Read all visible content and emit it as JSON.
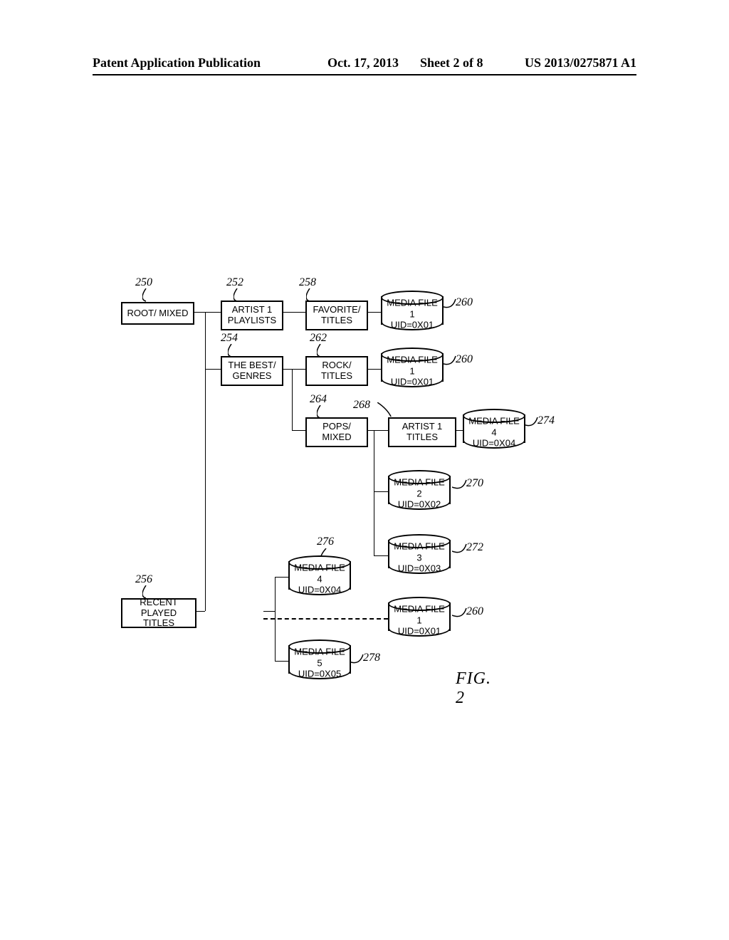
{
  "header": {
    "pubtype": "Patent Application Publication",
    "date": "Oct. 17, 2013",
    "sheet": "Sheet 2 of 8",
    "pubno": "US 2013/0275871 A1"
  },
  "refs": {
    "r250": "250",
    "r252": "252",
    "r254": "254",
    "r256": "256",
    "r258": "258",
    "r260": "260",
    "r262": "262",
    "r264": "264",
    "r268": "268",
    "r270": "270",
    "r272": "272",
    "r274": "274",
    "r276": "276",
    "r278": "278"
  },
  "nodes": {
    "root": {
      "l1": "ROOT/ MIXED"
    },
    "artist1_playlists": {
      "l1": "ARTIST 1",
      "l2": "PLAYLISTS"
    },
    "the_best_genres": {
      "l1": "THE BEST/",
      "l2": "GENRES"
    },
    "favorite_titles": {
      "l1": "FAVORITE/",
      "l2": "TITLES"
    },
    "rock_titles": {
      "l1": "ROCK/",
      "l2": "TITLES"
    },
    "pops_mixed": {
      "l1": "POPS/",
      "l2": "MIXED"
    },
    "artist1_titles": {
      "l1": "ARTIST 1",
      "l2": "TITLES"
    },
    "recent_played_titles": {
      "l1": "RECENT PLAYED",
      "l2": "TITLES"
    }
  },
  "files": {
    "mf1": {
      "l1": "MEDIA FILE 1",
      "l2": "UID=0X01"
    },
    "mf2": {
      "l1": "MEDIA FILE 2",
      "l2": "UID=0X02"
    },
    "mf3": {
      "l1": "MEDIA FILE 3",
      "l2": "UID=0X03"
    },
    "mf4": {
      "l1": "MEDIA FILE 4",
      "l2": "UID=0X04"
    },
    "mf5": {
      "l1": "MEDIA FILE 5",
      "l2": "UID=0X05"
    }
  },
  "figure": {
    "label": "FIG. 2"
  },
  "chart_data": {
    "type": "tree",
    "title": "FIG. 2",
    "nodes": [
      {
        "id": 250,
        "label": "ROOT/ MIXED",
        "children": [
          252,
          254,
          256
        ]
      },
      {
        "id": 252,
        "label": "ARTIST 1 PLAYLISTS",
        "children": [
          258
        ]
      },
      {
        "id": 254,
        "label": "THE BEST/ GENRES",
        "children": [
          262,
          264
        ]
      },
      {
        "id": 256,
        "label": "RECENT PLAYED TITLES",
        "children": [
          276,
          260,
          278
        ]
      },
      {
        "id": 258,
        "label": "FAVORITE/ TITLES",
        "children": [
          260
        ]
      },
      {
        "id": 262,
        "label": "ROCK/ TITLES",
        "children": [
          260
        ]
      },
      {
        "id": 264,
        "label": "POPS/ MIXED",
        "children": [
          268,
          270,
          272
        ]
      },
      {
        "id": 268,
        "label": "ARTIST 1 TITLES",
        "children": [
          274
        ]
      },
      {
        "id": 260,
        "label": "MEDIA FILE 1",
        "uid": "0X01"
      },
      {
        "id": 270,
        "label": "MEDIA FILE 2",
        "uid": "0X02"
      },
      {
        "id": 272,
        "label": "MEDIA FILE 3",
        "uid": "0X03"
      },
      {
        "id": 274,
        "label": "MEDIA FILE 4",
        "uid": "0X04"
      },
      {
        "id": 276,
        "label": "MEDIA FILE 4",
        "uid": "0X04"
      },
      {
        "id": 278,
        "label": "MEDIA FILE 5",
        "uid": "0X05"
      }
    ]
  }
}
